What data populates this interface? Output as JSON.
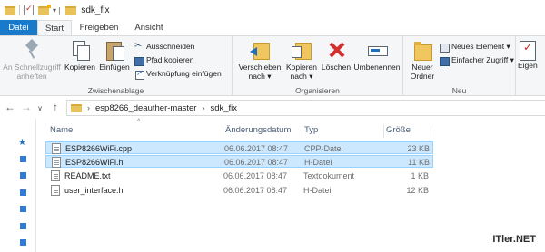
{
  "window": {
    "title": "sdk_fix"
  },
  "tabs": [
    {
      "label": "Datei"
    },
    {
      "label": "Start"
    },
    {
      "label": "Freigeben"
    },
    {
      "label": "Ansicht"
    }
  ],
  "ribbon": {
    "clipboard": {
      "title": "Zwischenablage",
      "pin_line1": "An Schnellzugriff",
      "pin_line2": "anheften",
      "copy": "Kopieren",
      "paste": "Einfügen",
      "cut": "Ausschneiden",
      "copy_path": "Pfad kopieren",
      "paste_shortcut": "Verknüpfung einfügen"
    },
    "organize": {
      "title": "Organisieren",
      "move_line1": "Verschieben",
      "move_line2": "nach ▾",
      "copy_line1": "Kopieren",
      "copy_line2": "nach ▾",
      "delete": "Löschen",
      "rename": "Umbenennen"
    },
    "new": {
      "title": "Neu",
      "folder_line1": "Neuer",
      "folder_line2": "Ordner",
      "new_item": "Neues Element ▾",
      "easy_access": "Einfacher Zugriff ▾"
    },
    "open": {
      "properties": "Eigen"
    }
  },
  "address": {
    "segments": [
      "esp8266_deauther-master",
      "sdk_fix"
    ]
  },
  "columns": {
    "name": "Name",
    "date": "Änderungsdatum",
    "type": "Typ",
    "size": "Größe"
  },
  "files": [
    {
      "name": "ESP8266WiFi.cpp",
      "date": "06.06.2017 08:47",
      "type": "CPP-Datei",
      "size": "23 KB",
      "selected": true
    },
    {
      "name": "ESP8266WiFi.h",
      "date": "06.06.2017 08:47",
      "type": "H-Datei",
      "size": "11 KB",
      "selected": true
    },
    {
      "name": "README.txt",
      "date": "06.06.2017 08:47",
      "type": "Textdokument",
      "size": "1 KB",
      "selected": false
    },
    {
      "name": "user_interface.h",
      "date": "06.06.2017 08:47",
      "type": "H-Datei",
      "size": "12 KB",
      "selected": false
    }
  ],
  "watermark": "ITler.NET",
  "colors": {
    "accent": "#1979ca",
    "selection": "#cce8ff",
    "selection_border": "#99d1ff",
    "delete_red": "#d32f2f"
  }
}
